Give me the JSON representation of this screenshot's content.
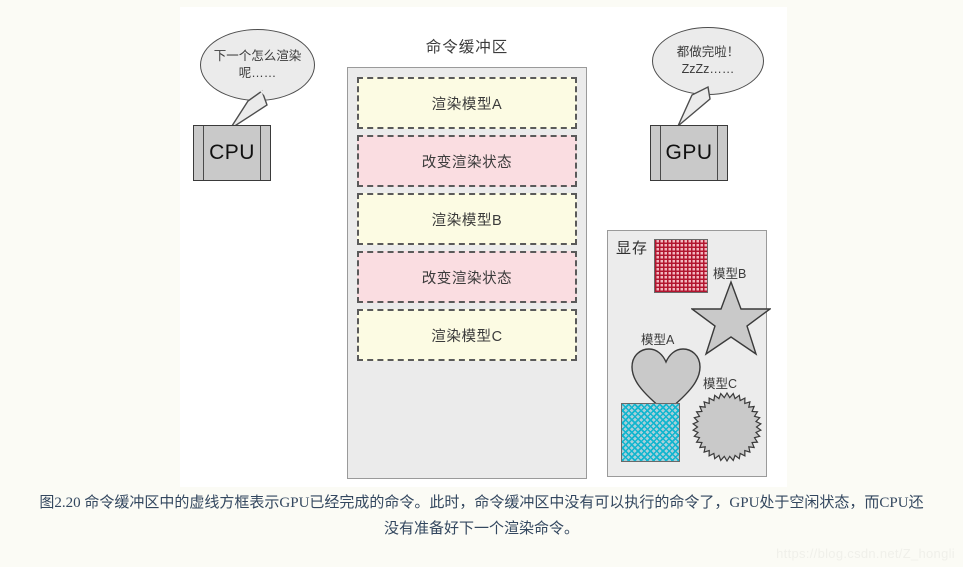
{
  "watermark": "https://blog.csdn.net/Z_hongli",
  "cpu": {
    "label": "CPU",
    "bubble_text": "下一个怎么渲染呢……"
  },
  "gpu": {
    "label": "GPU",
    "bubble_text": "都做完啦！ZzZz……"
  },
  "buffer": {
    "title": "命令缓冲区",
    "items": [
      {
        "label": "渲染模型A",
        "kind": "render"
      },
      {
        "label": "改变渲染状态",
        "kind": "state"
      },
      {
        "label": "渲染模型B",
        "kind": "render"
      },
      {
        "label": "改变渲染状态",
        "kind": "state"
      },
      {
        "label": "渲染模型C",
        "kind": "render"
      }
    ]
  },
  "vram": {
    "title": "显存",
    "labels": {
      "model_a": "模型A",
      "model_b": "模型B",
      "model_c": "模型C"
    }
  },
  "caption": {
    "line1": "图2.20 命令缓冲区中的虚线方框表示GPU已经完成的命令。此时，命令缓冲区中没有可以执行的命令了，GPU处于空闲状态，而CPU还",
    "line2": "没有准备好下一个渲染命令。"
  },
  "colors": {
    "render_fill": "#fcfbe3",
    "state_fill": "#fadde1",
    "panel_bg": "#ebebeb",
    "proc_fill": "#c9c9c9",
    "shape_fill": "#c9c9c9",
    "red_hatch": "#b2152f",
    "cyan_hatch": "#11b6cf",
    "caption_color": "#33475f"
  }
}
